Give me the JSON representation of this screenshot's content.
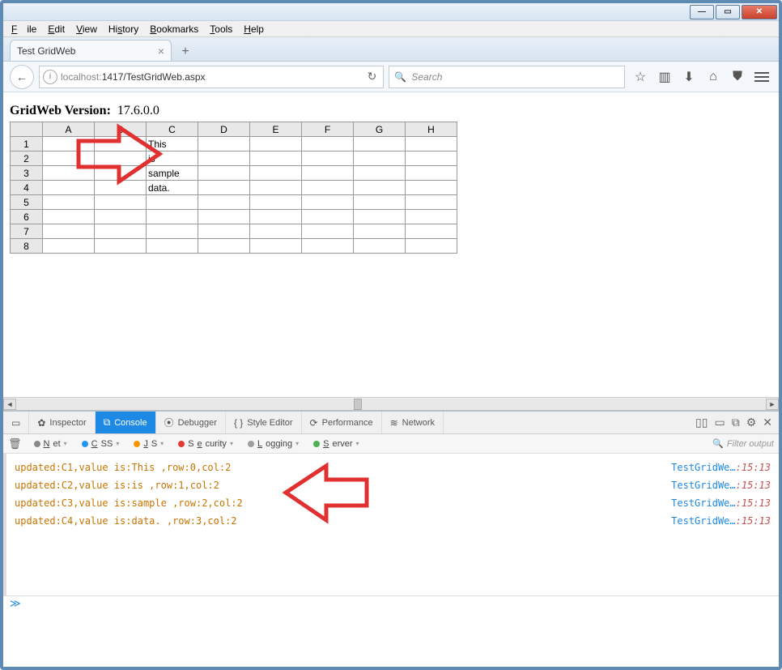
{
  "menu": {
    "file": "File",
    "edit": "Edit",
    "view": "View",
    "history": "History",
    "bookmarks": "Bookmarks",
    "tools": "Tools",
    "help": "Help"
  },
  "tab": {
    "title": "Test GridWeb"
  },
  "url": {
    "prefix": "localhost:",
    "host": "1417/TestGridWeb.aspx"
  },
  "search": {
    "placeholder": "Search"
  },
  "version": {
    "label": "GridWeb Version:",
    "value": "17.6.0.0"
  },
  "grid": {
    "cols": [
      "A",
      "B",
      "C",
      "D",
      "E",
      "F",
      "G",
      "H"
    ],
    "rows": [
      "1",
      "2",
      "3",
      "4",
      "5",
      "6",
      "7",
      "8"
    ],
    "cells": {
      "C1": "This",
      "C2": "is",
      "C3": "sample",
      "C4": "data."
    }
  },
  "devtools": {
    "tabs": {
      "inspector": "Inspector",
      "console": "Console",
      "debugger": "Debugger",
      "styleeditor": "Style Editor",
      "performance": "Performance",
      "network": "Network"
    },
    "filters": {
      "net": "Net",
      "css": "CSS",
      "js": "JS",
      "security": "Security",
      "logging": "Logging",
      "server": "Server"
    },
    "filter_placeholder": "Filter output",
    "logs": [
      {
        "msg": "updated:C1,value is:This ,row:0,col:2",
        "src": "TestGridWe…",
        "time": ":15:13"
      },
      {
        "msg": "updated:C2,value is:is ,row:1,col:2",
        "src": "TestGridWe…",
        "time": ":15:13"
      },
      {
        "msg": "updated:C3,value is:sample ,row:2,col:2",
        "src": "TestGridWe…",
        "time": ":15:13"
      },
      {
        "msg": "updated:C4,value is:data. ,row:3,col:2",
        "src": "TestGridWe…",
        "time": ":15:13"
      }
    ],
    "prompt": "≫"
  }
}
